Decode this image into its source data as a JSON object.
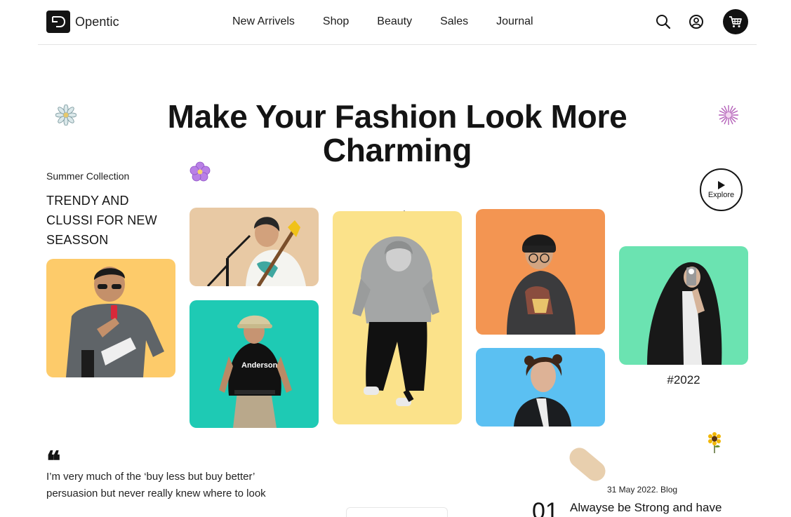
{
  "brand": {
    "name": "Opentic",
    "icon": "opentic-logo-icon"
  },
  "nav": {
    "items": [
      {
        "label": "New Arrivels"
      },
      {
        "label": "Shop"
      },
      {
        "label": "Beauty"
      },
      {
        "label": "Sales"
      },
      {
        "label": "Journal"
      }
    ]
  },
  "header_actions": {
    "search_icon": "search-icon",
    "account_icon": "user-circle-icon",
    "cart_icon": "shopping-cart-icon"
  },
  "hero": {
    "headline": "Make Your Fashion Look More Charming",
    "collection_label": "Summer Collection",
    "collection_title": "TRENDY AND CLUSSI FOR NEW SEASSON",
    "explore_label": "Explore",
    "year_tag": "#2022"
  },
  "gallery": {
    "cards": [
      {
        "name": "photo-card-sunglasses",
        "bg": "#fdcb6a"
      },
      {
        "name": "photo-card-guitarist",
        "bg": "#e8c9a4"
      },
      {
        "name": "photo-card-bucket-hat",
        "bg": "#1ecab4"
      },
      {
        "name": "photo-card-hoodie",
        "bg": "#fbe28a"
      },
      {
        "name": "photo-card-beanie",
        "bg": "#f39552"
      },
      {
        "name": "photo-card-curly-hair",
        "bg": "#5bc0f2"
      },
      {
        "name": "photo-card-selfie",
        "bg": "#6be3b1"
      }
    ]
  },
  "testimonial": {
    "mark": "❝",
    "text": "I’m very much of the ‘buy less but buy better’ persuasion but never really knew where to look"
  },
  "blog": {
    "meta": "31 May 2022. Blog",
    "number": "01",
    "title": "Alwayse be Strong and have"
  },
  "colors": {
    "text": "#141414",
    "accent_dark": "#111111"
  }
}
